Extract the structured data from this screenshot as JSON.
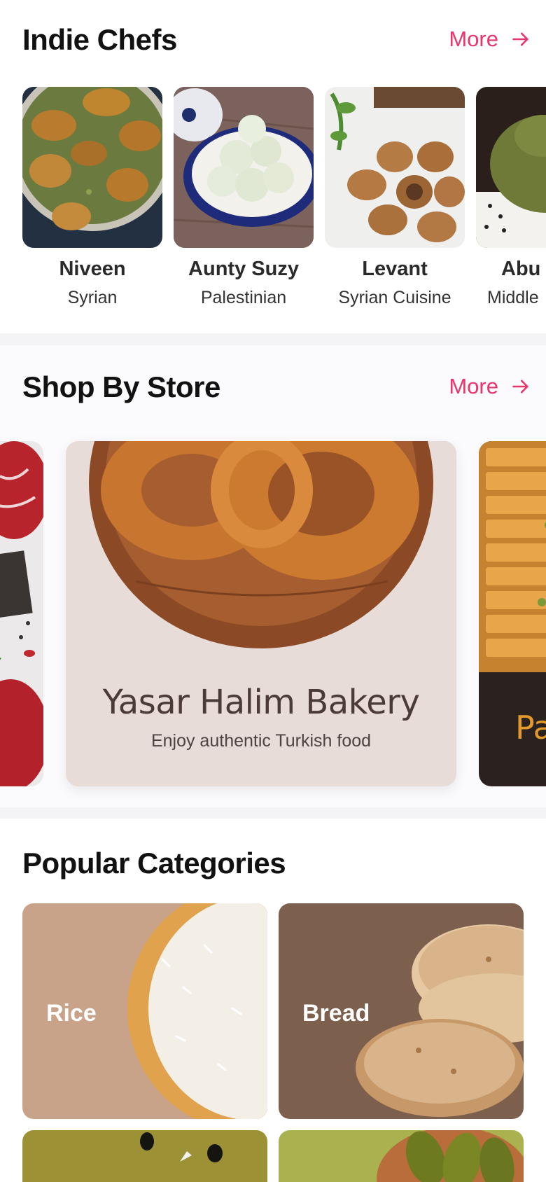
{
  "chefs_section": {
    "title": "Indie Chefs",
    "more_label": "More",
    "chefs": [
      {
        "name": "Niveen",
        "cuisine": "Syrian"
      },
      {
        "name": "Aunty Suzy",
        "cuisine": "Palestinian"
      },
      {
        "name": "Levant",
        "cuisine": "Syrian Cuisine"
      },
      {
        "name": "Abu Z",
        "cuisine": "Middle"
      }
    ]
  },
  "stores_section": {
    "title": "Shop By Store",
    "more_label": "More",
    "featured_store": {
      "name": "Yasar Halim Bakery",
      "description": "Enjoy authentic Turkish food"
    },
    "next_store_partial": "Pa"
  },
  "categories_section": {
    "title": "Popular Categories",
    "categories": [
      {
        "label": "Rice",
        "color": "#c8a38a"
      },
      {
        "label": "Bread",
        "color": "#7d5f4e"
      },
      {
        "label": "",
        "color": "#9c9134"
      },
      {
        "label": "",
        "color": "#a9b24f"
      }
    ]
  },
  "colors": {
    "accent": "#e8356c",
    "divider": "#f4f3f6"
  },
  "icons": {
    "more": "arrow-right-icon"
  }
}
